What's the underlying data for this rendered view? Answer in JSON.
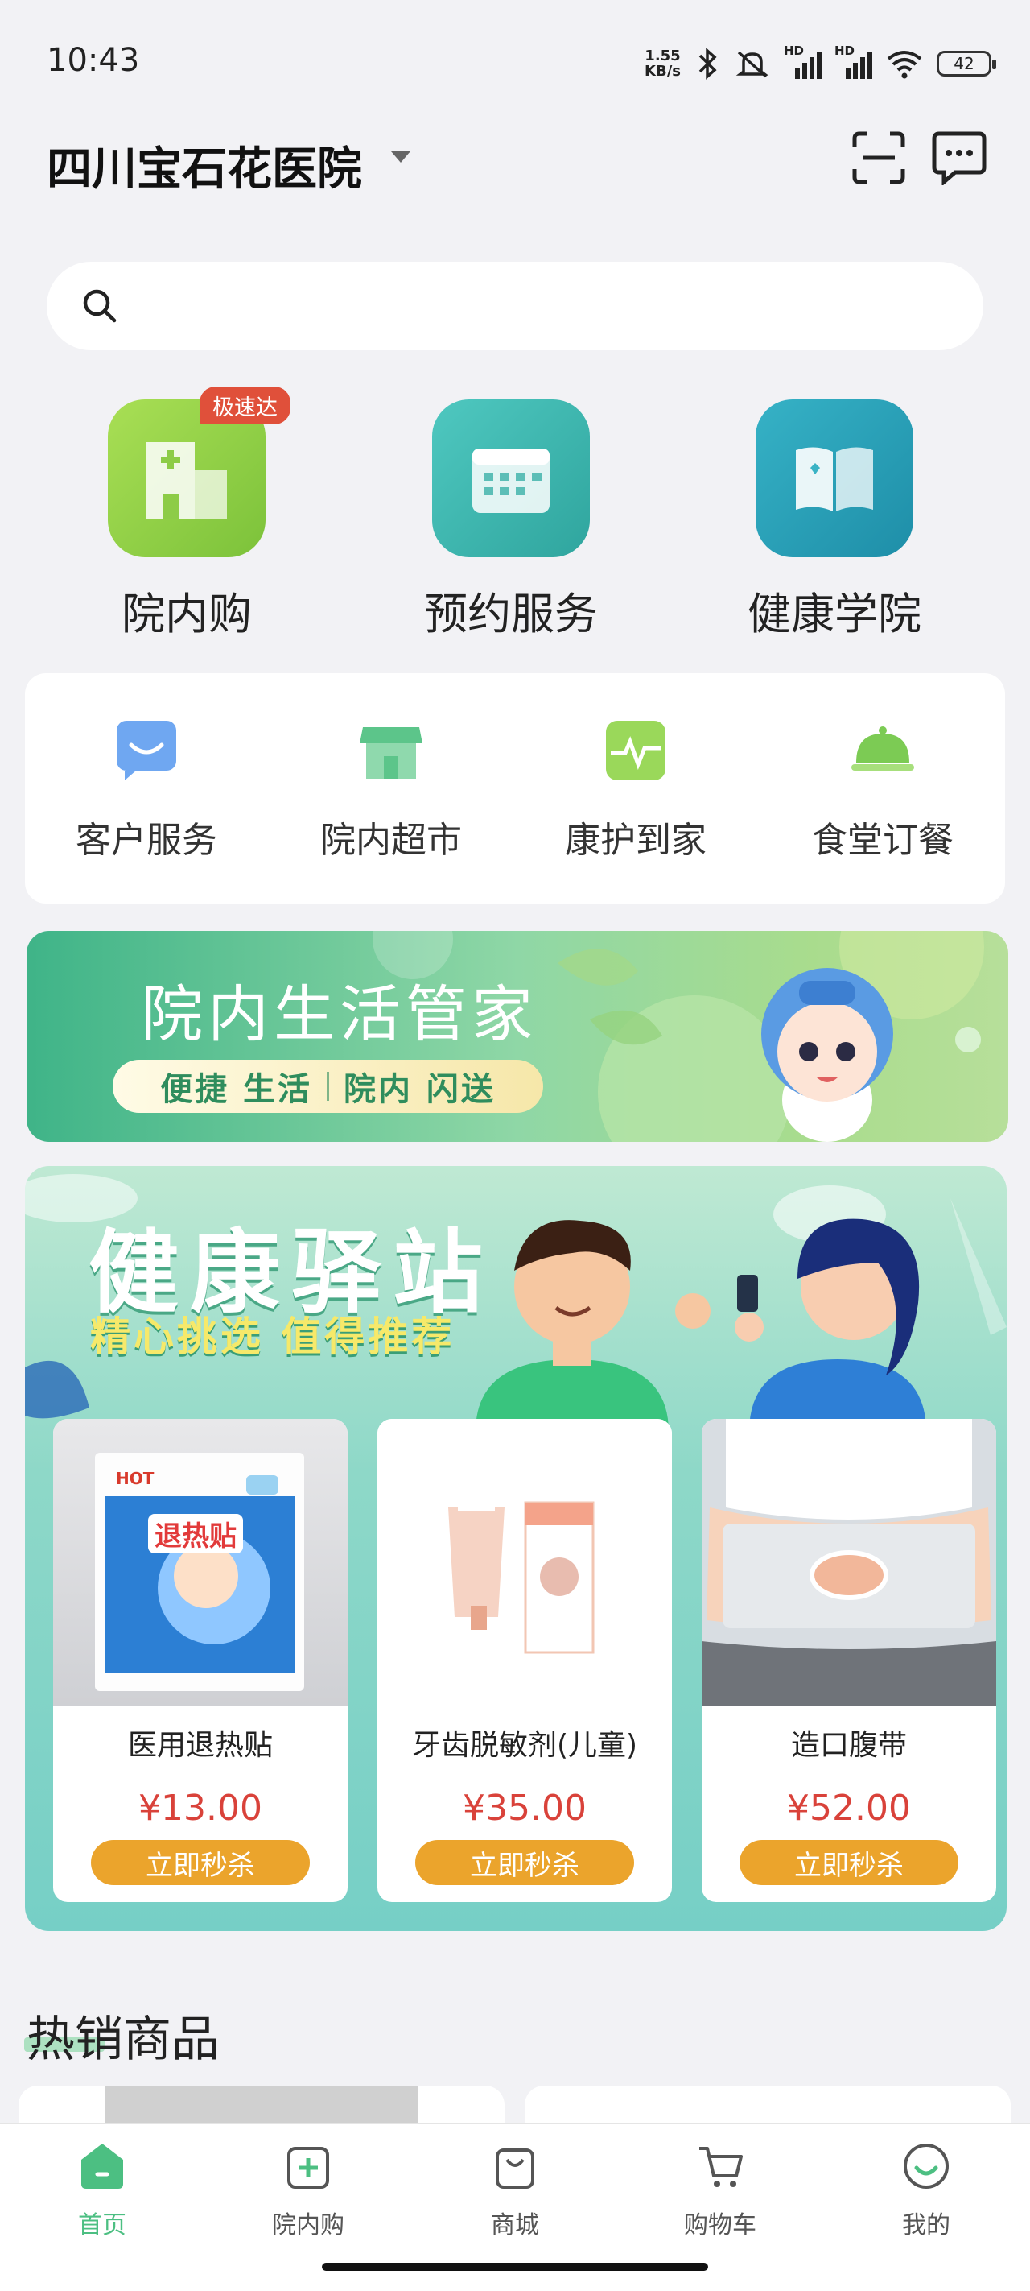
{
  "status_bar": {
    "time": "10:43",
    "net_speed_value": "1.55",
    "net_speed_unit": "KB/s",
    "signal_1_label": "HD",
    "signal_2_label": "HD",
    "battery": "42"
  },
  "header": {
    "hospital_name": "四川宝石花医院"
  },
  "search": {
    "placeholder": ""
  },
  "big_entries": [
    {
      "label": "院内购",
      "badge": "极速达"
    },
    {
      "label": "预约服务"
    },
    {
      "label": "健康学院"
    }
  ],
  "services": [
    {
      "label": "客户服务"
    },
    {
      "label": "院内超市"
    },
    {
      "label": "康护到家"
    },
    {
      "label": "食堂订餐"
    }
  ],
  "life_banner": {
    "title": "院内生活管家",
    "pill_left": "便捷 生活",
    "pill_right": "院内 闪送"
  },
  "health_station": {
    "title": "健康驿站",
    "subtitle": "精心挑选 值得推荐",
    "products": [
      {
        "name": "医用退热贴",
        "price": "¥13.00",
        "button": "立即秒杀",
        "box_brand": "HOT",
        "box_text": "退热贴"
      },
      {
        "name": "牙齿脱敏剂(儿童)",
        "price": "¥35.00",
        "button": "立即秒杀"
      },
      {
        "name": "造口腹带",
        "price": "¥52.00",
        "button": "立即秒杀"
      }
    ]
  },
  "hot_section": {
    "title": "热销商品"
  },
  "tab_bar": [
    {
      "label": "首页",
      "active": true
    },
    {
      "label": "院内购"
    },
    {
      "label": "商城"
    },
    {
      "label": "购物车"
    },
    {
      "label": "我的"
    }
  ],
  "colors": {
    "accent_green": "#4cbf82",
    "price_red": "#d9423a",
    "buy_orange": "#eba42c",
    "badge_red": "#e0503a"
  }
}
